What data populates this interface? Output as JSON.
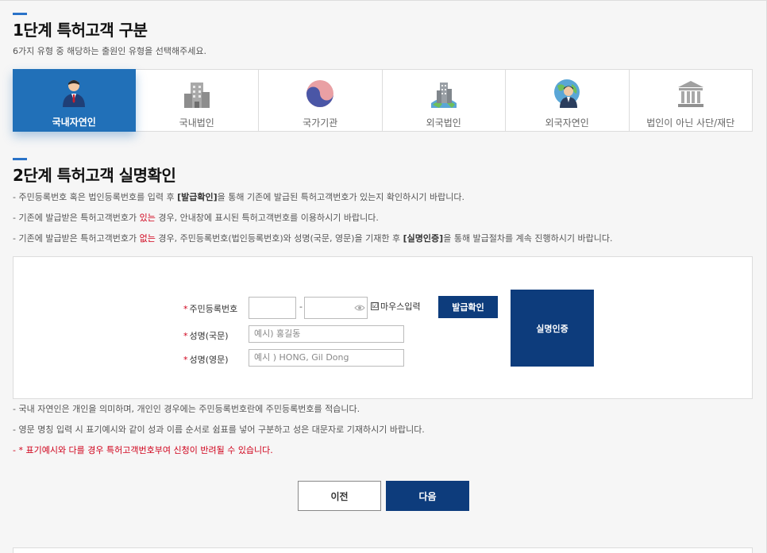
{
  "step1": {
    "title": "1단계 특허고객 구분",
    "subtitle": "6가지 유형 중 해당하는 출원인 유형을 선택해주세요.",
    "types": [
      {
        "label": "국내자연인",
        "icon": "person-icon",
        "active": true
      },
      {
        "label": "국내법인",
        "icon": "building-icon",
        "active": false
      },
      {
        "label": "국가기관",
        "icon": "taegeuk-icon",
        "active": false
      },
      {
        "label": "외국법인",
        "icon": "globe-building-icon",
        "active": false
      },
      {
        "label": "외국자연인",
        "icon": "globe-person-icon",
        "active": false
      },
      {
        "label": "법인이 아닌 사단/재단",
        "icon": "institution-icon",
        "active": false
      }
    ]
  },
  "step2": {
    "title": "2단계 특허고객 실명확인",
    "notes": [
      {
        "pre": "- 주민등록번호 혹은 법인등록번호를 입력 후 ",
        "bold": "[발급확인]",
        "post": "을 통해 기존에 발급된 특허고객번호가 있는지 확인하시기 바랍니다."
      },
      {
        "pre": "- 기존에 발급받은 특허고객번호가 ",
        "red": "있는",
        "post": " 경우, 안내창에 표시된 특허고객번호를 이용하시기 바랍니다."
      },
      {
        "pre": "- 기존에 발급받은 특허고객번호가 ",
        "red": "없는",
        "mid": " 경우, 주민등록번호(법인등록번호)와 성명(국문, 영문)을 기재한 후 ",
        "bold": "[실명인증]",
        "post": "을 통해 발급절차를 계속 진행하시기 바랍니다."
      }
    ]
  },
  "form": {
    "rrn_label": "주민등록번호",
    "rrn_dash": "-",
    "mouse_input_label": "마우스입력",
    "mouse_input_checkbox": "☑",
    "name_kr_label": "성명(국문)",
    "name_kr_placeholder": "예시) 홍길동",
    "name_en_label": "성명(영문)",
    "name_en_placeholder": "예시 ) HONG, Gil Dong",
    "star": "*",
    "issue_check_button": "발급확인",
    "verify_button": "실명인증"
  },
  "footnotes": {
    "note1": "- 국내 자연인은 개인을 의미하며, 개인인 경우에는 주민등록번호란에 주민등록번호를 적습니다.",
    "note2": "- 영문 명칭 입력 시 표기예시와 같이 성과 이름 순서로 쉼표를 넣어 구분하고 성은 대문자로 기재하시기 바랍니다.",
    "note3": "- * 표기예시와 다를 경우 특허고객번호부여 신청이 반려될 수 있습니다."
  },
  "nav": {
    "prev": "이전",
    "next": "다음"
  },
  "colors": {
    "accent": "#2170b8",
    "dark_button": "#0d3c7c",
    "warning": "#d0021b"
  }
}
